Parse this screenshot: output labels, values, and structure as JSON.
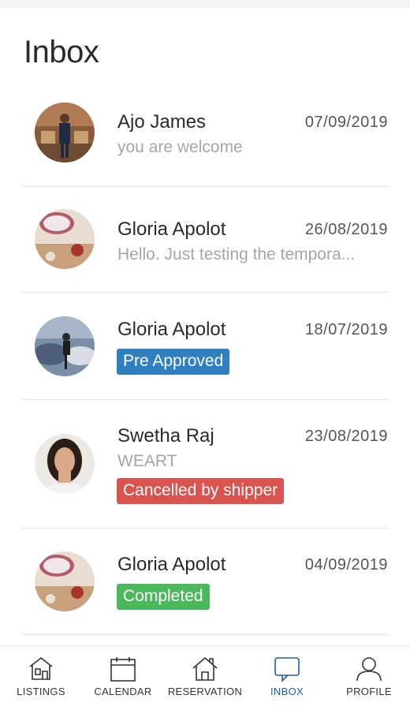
{
  "header": {
    "title": "Inbox"
  },
  "threads": [
    {
      "name": "Ajo James",
      "date": "07/09/2019",
      "preview": "you are welcome",
      "badge": null
    },
    {
      "name": "Gloria Apolot",
      "date": "26/08/2019",
      "preview": "Hello. Just testing the tempora...",
      "badge": null
    },
    {
      "name": "Gloria Apolot",
      "date": "18/07/2019",
      "preview": null,
      "badge": {
        "label": "Pre Approved",
        "color": "#2f7fc1"
      }
    },
    {
      "name": "Swetha Raj",
      "date": "23/08/2019",
      "preview": "WEART",
      "badge": {
        "label": "Cancelled by shipper",
        "color": "#d9534f"
      }
    },
    {
      "name": "Gloria Apolot",
      "date": "04/09/2019",
      "preview": null,
      "badge": {
        "label": "Completed",
        "color": "#4cb85c"
      }
    }
  ],
  "tabs": [
    {
      "label": "LISTINGS",
      "icon": "listings-house-icon",
      "active": false
    },
    {
      "label": "CALENDAR",
      "icon": "calendar-icon",
      "active": false
    },
    {
      "label": "RESERVATION",
      "icon": "reservation-house-icon",
      "active": false
    },
    {
      "label": "INBOX",
      "icon": "inbox-chat-icon",
      "active": true
    },
    {
      "label": "PROFILE",
      "icon": "profile-icon",
      "active": false
    }
  ],
  "colors": {
    "accent": "#1a5db3",
    "text": "#2a2a2a",
    "muted": "#a5a5a5",
    "divider": "#e3e3e3"
  }
}
